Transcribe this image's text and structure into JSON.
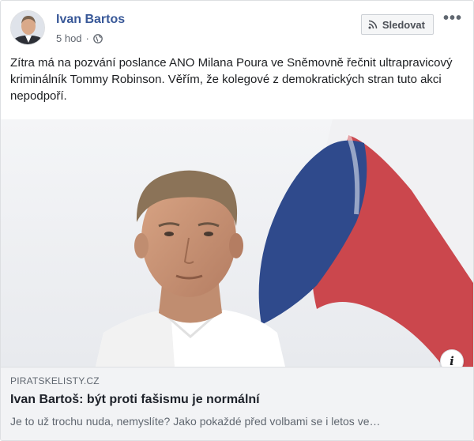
{
  "post": {
    "author": "Ivan Bartos",
    "time": "5 hod",
    "separator": "·",
    "follow_label": "Sledovat",
    "more_label": "•••",
    "text": "Zítra má na pozvání poslance ANO Milana Poura ve Sněmovně řečnit ultrapravicový kriminálník Tommy Robinson. Věřím, že kolegové z demokratických stran tuto akci nepodpoří."
  },
  "link": {
    "domain": "PIRATSKELISTY.CZ",
    "title": "Ivan Bartoš: být proti fašismu je normální",
    "description": "Je to už trochu nuda, nemyslíte? Jako pokaždé před volbami se i letos ve…",
    "info_label": "i"
  },
  "colors": {
    "author": "#385898",
    "flag_blue": "#2f4a8c",
    "flag_red": "#c8383f"
  },
  "icons": [
    "globe-icon",
    "rss-icon",
    "info-icon",
    "more-icon"
  ]
}
